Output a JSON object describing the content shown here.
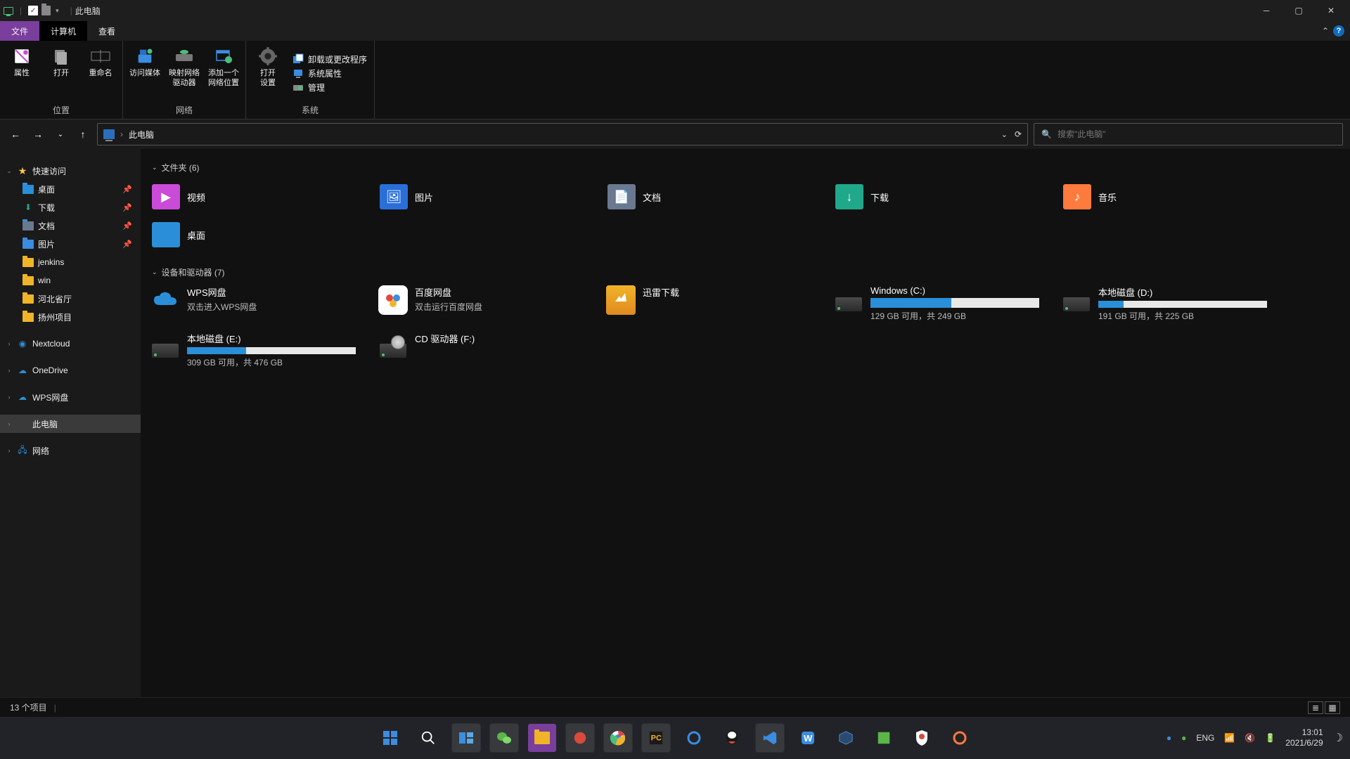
{
  "titlebar": {
    "title": "此电脑"
  },
  "tabs": {
    "file": "文件",
    "computer": "计算机",
    "view": "查看"
  },
  "ribbon": {
    "group_location": {
      "label": "位置",
      "props": "属性",
      "open": "打开",
      "rename": "重命名"
    },
    "group_network": {
      "label": "网络",
      "access_media": "访问媒体",
      "map_drive": "映射网络\n驱动器",
      "add_location": "添加一个\n网络位置"
    },
    "group_system": {
      "label": "系统",
      "open_settings": "打开\n设置",
      "uninstall": "卸载或更改程序",
      "sysprops": "系统属性",
      "manage": "管理"
    }
  },
  "breadcrumb": {
    "current": "此电脑"
  },
  "search": {
    "placeholder": "搜索\"此电脑\""
  },
  "sidebar": {
    "quick_access": "快速访问",
    "desktop": "桌面",
    "downloads": "下载",
    "documents": "文档",
    "pictures": "图片",
    "jenkins": "jenkins",
    "win": "win",
    "hebei": "河北省厅",
    "yangzhou": "扬州项目",
    "nextcloud": "Nextcloud",
    "onedrive": "OneDrive",
    "wps": "WPS网盘",
    "this_pc": "此电脑",
    "network": "网络"
  },
  "sections": {
    "folders": {
      "header": "文件夹 (6)"
    },
    "drives": {
      "header": "设备和驱动器 (7)"
    }
  },
  "folders": [
    {
      "name": "视频",
      "color": "#c94bd8",
      "glyph": "▶"
    },
    {
      "name": "图片",
      "color": "#2a6fd8",
      "glyph": "🖼"
    },
    {
      "name": "文档",
      "color": "#6a7890",
      "glyph": "📄"
    },
    {
      "name": "下载",
      "color": "#1fa88a",
      "glyph": "↓"
    },
    {
      "name": "音乐",
      "color": "#ff7a3d",
      "glyph": "♪"
    },
    {
      "name": "桌面",
      "color": "#2a8fd8",
      "glyph": ""
    }
  ],
  "drives": [
    {
      "name": "WPS网盘",
      "sub": "双击进入WPS网盘",
      "kind": "cloud",
      "color": "#2a8fd8"
    },
    {
      "name": "百度网盘",
      "sub": "双击运行百度网盘",
      "kind": "app",
      "color": "#ffffff"
    },
    {
      "name": "迅雷下载",
      "sub": "",
      "kind": "app2",
      "color": "#f0b429"
    },
    {
      "name": "Windows (C:)",
      "sub": "129 GB 可用，共 249 GB",
      "kind": "disk",
      "pct": 48
    },
    {
      "name": "本地磁盘 (D:)",
      "sub": "191 GB 可用，共 225 GB",
      "kind": "disk",
      "pct": 15
    },
    {
      "name": "本地磁盘 (E:)",
      "sub": "309 GB 可用，共 476 GB",
      "kind": "disk",
      "pct": 35
    },
    {
      "name": "CD 驱动器 (F:)",
      "sub": "",
      "kind": "cd"
    }
  ],
  "statusbar": {
    "items": "13 个项目"
  },
  "tray": {
    "lang": "ENG",
    "time": "13:01",
    "date": "2021/6/29"
  }
}
